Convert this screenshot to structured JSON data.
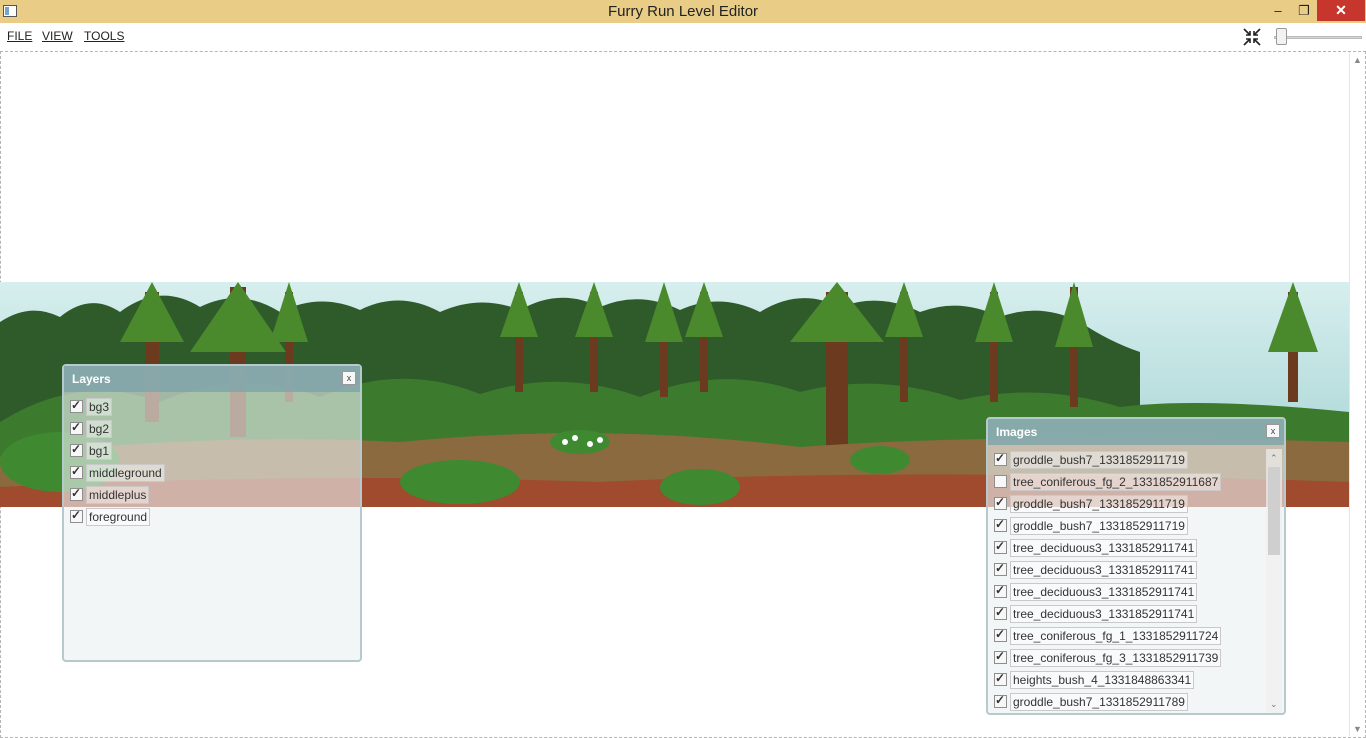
{
  "window": {
    "title": "Furry Run Level Editor",
    "minimize": "‒",
    "maximize": "❐",
    "close": "✕"
  },
  "menu": {
    "file": "FILE",
    "view": "VIEW",
    "tools": "TOOLS"
  },
  "zoom": {
    "level": 0.05
  },
  "layers_panel": {
    "title": "Layers",
    "close": "x",
    "items": [
      {
        "label": "bg3",
        "checked": true
      },
      {
        "label": "bg2",
        "checked": true
      },
      {
        "label": "bg1",
        "checked": true
      },
      {
        "label": "middleground",
        "checked": true
      },
      {
        "label": "middleplus",
        "checked": true
      },
      {
        "label": "foreground",
        "checked": true
      }
    ]
  },
  "images_panel": {
    "title": "Images",
    "close": "x",
    "items": [
      {
        "label": "groddle_bush7_1331852911719",
        "checked": true
      },
      {
        "label": "tree_coniferous_fg_2_1331852911687",
        "checked": false
      },
      {
        "label": "groddle_bush7_1331852911719",
        "checked": true
      },
      {
        "label": "groddle_bush7_1331852911719",
        "checked": true
      },
      {
        "label": "tree_deciduous3_1331852911741",
        "checked": true
      },
      {
        "label": "tree_deciduous3_1331852911741",
        "checked": true
      },
      {
        "label": "tree_deciduous3_1331852911741",
        "checked": true
      },
      {
        "label": "tree_deciduous3_1331852911741",
        "checked": true
      },
      {
        "label": "tree_coniferous_fg_1_1331852911724",
        "checked": true
      },
      {
        "label": "tree_coniferous_fg_3_1331852911739",
        "checked": true
      },
      {
        "label": "heights_bush_4_1331848863341",
        "checked": true
      },
      {
        "label": "groddle_bush7_1331852911789",
        "checked": true
      }
    ]
  },
  "colors": {
    "titlebar": "#e9cd86",
    "close_button": "#c7362c",
    "panel_header": "#80a4aa",
    "sky": "#dff0f0",
    "ground": "#8a6a3e"
  }
}
